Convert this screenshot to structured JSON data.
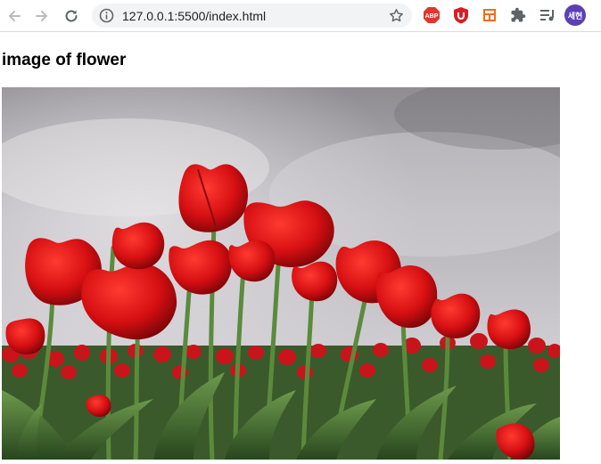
{
  "browser": {
    "url": "127.0.0.1:5500/index.html",
    "icons": {
      "back": "arrow-left-icon",
      "forward": "arrow-right-icon",
      "reload": "reload-icon",
      "site_info": "info-icon",
      "bookmark": "star-icon",
      "extensions": [
        "adblock-plus-icon",
        "ublock-icon",
        "layout-extension-icon",
        "puzzle-icon",
        "media-queue-icon"
      ]
    },
    "profile_label": "세현",
    "colors": {
      "avatar": "#5c3fb5",
      "abp": "#e3342f",
      "ublock": "#d61f26",
      "layout_ext": "#f26b1d"
    }
  },
  "page": {
    "heading": "image of flower",
    "image": {
      "subject": "red-tulips-photo"
    }
  }
}
